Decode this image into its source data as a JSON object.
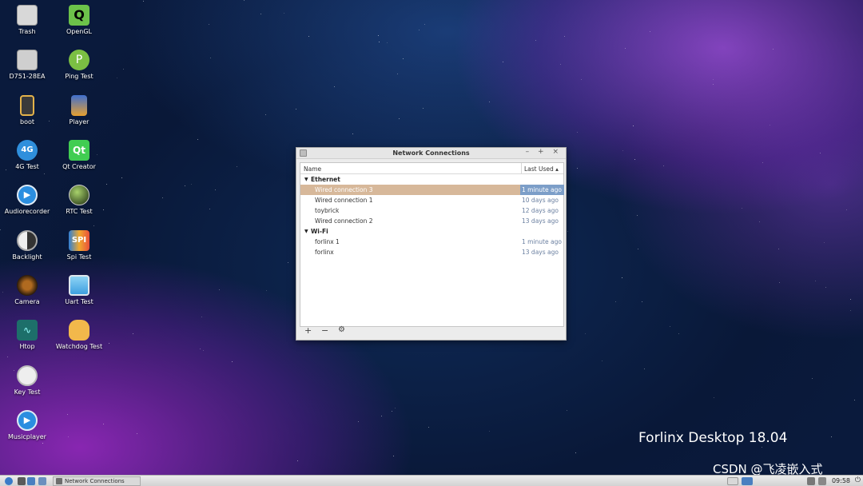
{
  "desktop": {
    "icons": [
      {
        "label": "Trash",
        "icon": "trash-icon",
        "color": "#e0e0e0"
      },
      {
        "label": "OpenGL",
        "icon": "opengl-icon",
        "color": "#5ab13a"
      },
      {
        "label": "D751-28EA",
        "icon": "usb-drive-icon",
        "color": "#d0d0d0"
      },
      {
        "label": "Ping Test",
        "icon": "ping-icon",
        "color": "#7bbf43"
      },
      {
        "label": "boot",
        "icon": "drive-icon",
        "color": "#c8a040"
      },
      {
        "label": "Player",
        "icon": "film-icon",
        "color": "#4b7fd1"
      },
      {
        "label": "4G Test",
        "icon": "4g-icon",
        "color": "#2f8fdc"
      },
      {
        "label": "Qt Creator",
        "icon": "qt-icon",
        "color": "#41cd52"
      },
      {
        "label": "Audiorecorder",
        "icon": "play-icon",
        "color": "#2b8ee0"
      },
      {
        "label": "RTC Test",
        "icon": "globe-icon",
        "color": "#4c6b2f"
      },
      {
        "label": "Backlight",
        "icon": "brightness-icon",
        "color": "#bdbdbd"
      },
      {
        "label": "Spi Test",
        "icon": "spi-icon",
        "color": "#2f7fd6"
      },
      {
        "label": "Camera",
        "icon": "camera-icon",
        "color": "#8a5a1e"
      },
      {
        "label": "Uart Test",
        "icon": "monitor-icon",
        "color": "#3d9fe0"
      },
      {
        "label": "Htop",
        "icon": "activity-icon",
        "color": "#1d8a80"
      },
      {
        "label": "Watchdog Test",
        "icon": "cat-icon",
        "color": "#f2b84b"
      },
      {
        "label": "Key Test",
        "icon": "key-icon",
        "color": "#e8e8e8"
      },
      {
        "label": "Musicplayer",
        "icon": "play-icon",
        "color": "#2b8ee0"
      }
    ],
    "brand": "Forlinx Desktop 18.04",
    "watermark": "CSDN @飞凌嵌入式"
  },
  "window": {
    "title": "Network Connections",
    "controls": {
      "minimize": "–",
      "maximize": "+",
      "close": "×"
    },
    "columns": {
      "name": "Name",
      "last_used": "Last Used ▴"
    },
    "groups": [
      {
        "label": "Ethernet",
        "rows": [
          {
            "name": "Wired connection 3",
            "last_used": "1 minute ago",
            "selected": true
          },
          {
            "name": "Wired connection 1",
            "last_used": "10 days ago"
          },
          {
            "name": "toybrick",
            "last_used": "12 days ago"
          },
          {
            "name": "Wired connection 2",
            "last_used": "13 days ago"
          }
        ]
      },
      {
        "label": "Wi-Fi",
        "rows": [
          {
            "name": "forlinx 1",
            "last_used": "1 minute ago"
          },
          {
            "name": "forlinx",
            "last_used": "13 days ago"
          }
        ]
      }
    ],
    "footer": {
      "add": "+",
      "remove": "−",
      "settings": "⚙"
    }
  },
  "taskbar": {
    "task_label": "Network Connections",
    "clock": "09:58",
    "power": "⏻"
  },
  "colors": {
    "selection": "#d7b89a",
    "selection_time": "#7c9ec8"
  }
}
